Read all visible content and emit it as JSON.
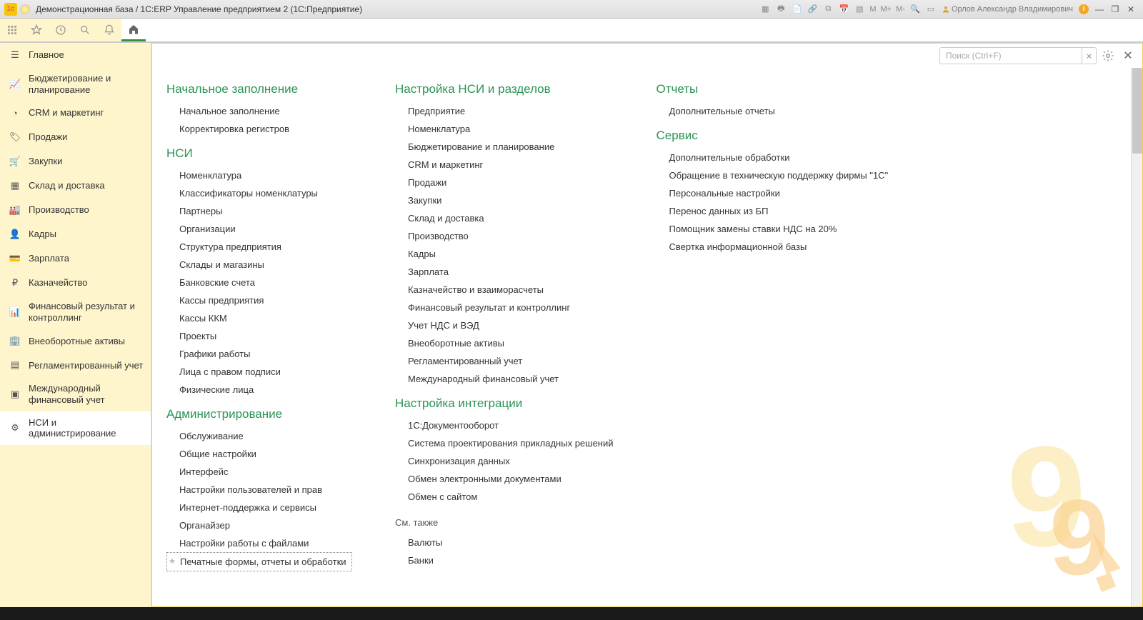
{
  "titlebar": {
    "title": "Демонстрационная база / 1С:ERP Управление предприятием 2  (1С:Предприятие)",
    "scale_m": "M",
    "scale_mp": "M+",
    "scale_mm": "M-",
    "user": "Орлов Александр Владимирович"
  },
  "search": {
    "placeholder": "Поиск (Ctrl+F)",
    "clear": "×"
  },
  "sidebar": {
    "items": [
      {
        "label": "Главное"
      },
      {
        "label": "Бюджетирование и планирование"
      },
      {
        "label": "CRM и маркетинг"
      },
      {
        "label": "Продажи"
      },
      {
        "label": "Закупки"
      },
      {
        "label": "Склад и доставка"
      },
      {
        "label": "Производство"
      },
      {
        "label": "Кадры"
      },
      {
        "label": "Зарплата"
      },
      {
        "label": "Казначейство"
      },
      {
        "label": "Финансовый результат и контроллинг"
      },
      {
        "label": "Внеоборотные активы"
      },
      {
        "label": "Регламентированный учет"
      },
      {
        "label": "Международный финансовый учет"
      },
      {
        "label": "НСИ и администрирование"
      }
    ]
  },
  "col1": {
    "s1_head": "Начальное заполнение",
    "s1_items": [
      "Начальное заполнение",
      "Корректировка регистров"
    ],
    "s2_head": "НСИ",
    "s2_items": [
      "Номенклатура",
      "Классификаторы номенклатуры",
      "Партнеры",
      "Организации",
      "Структура предприятия",
      "Склады и магазины",
      "Банковские счета",
      "Кассы предприятия",
      "Кассы ККМ",
      "Проекты",
      "Графики работы",
      "Лица с правом подписи",
      "Физические лица"
    ],
    "s3_head": "Администрирование",
    "s3_items": [
      "Обслуживание",
      "Общие настройки",
      "Интерфейс",
      "Настройки пользователей и прав",
      "Интернет-поддержка и сервисы",
      "Органайзер",
      "Настройки работы с файлами",
      "Печатные формы, отчеты и обработки"
    ]
  },
  "col2": {
    "s1_head": "Настройка НСИ и разделов",
    "s1_items": [
      "Предприятие",
      "Номенклатура",
      "Бюджетирование и планирование",
      "CRM и маркетинг",
      "Продажи",
      "Закупки",
      "Склад и доставка",
      "Производство",
      "Кадры",
      "Зарплата",
      "Казначейство и взаиморасчеты",
      "Финансовый результат и контроллинг",
      "Учет НДС и ВЭД",
      "Внеоборотные активы",
      "Регламентированный учет",
      "Международный финансовый учет"
    ],
    "s2_head": "Настройка интеграции",
    "s2_items": [
      "1С:Документооборот",
      "Система проектирования прикладных решений",
      "Синхронизация данных",
      "Обмен электронными документами",
      "Обмен с сайтом"
    ],
    "s3_head": "См. также",
    "s3_items": [
      "Валюты",
      "Банки"
    ]
  },
  "col3": {
    "s1_head": "Отчеты",
    "s1_items": [
      "Дополнительные отчеты"
    ],
    "s2_head": "Сервис",
    "s2_items": [
      "Дополнительные обработки",
      "Обращение в техническую поддержку фирмы \"1С\"",
      "Персональные настройки",
      "Перенос данных из БП",
      "Помощник замены ставки НДС на 20%",
      "Свертка информационной базы"
    ]
  }
}
